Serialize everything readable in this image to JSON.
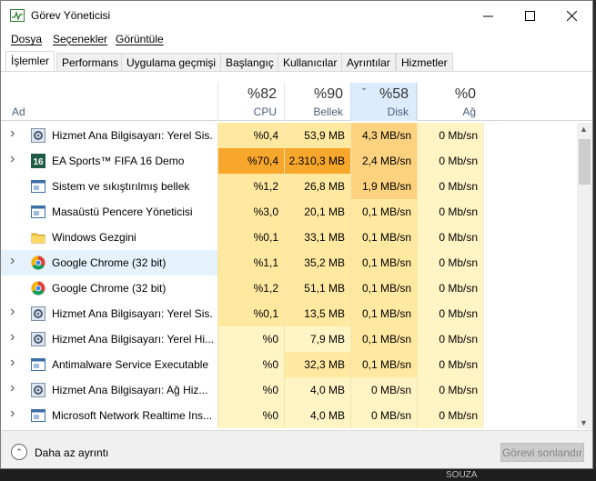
{
  "window": {
    "title": "Görev Yöneticisi"
  },
  "menu": [
    "Dosya",
    "Seçenekler",
    "Görüntüle"
  ],
  "tabs": [
    "İşlemler",
    "Performans",
    "Uygulama geçmişi",
    "Başlangıç",
    "Kullanıcılar",
    "Ayrıntılar",
    "Hizmetler"
  ],
  "columns": {
    "name": "Ad",
    "cpu": {
      "pct": "%82",
      "label": "CPU"
    },
    "mem": {
      "pct": "%90",
      "label": "Bellek"
    },
    "disk": {
      "pct": "%58",
      "label": "Disk"
    },
    "net": {
      "pct": "%0",
      "label": "Ağ"
    }
  },
  "processes": [
    {
      "name": "Hizmet Ana Bilgisayarı: Yerel Sis...",
      "cpu": "%0,4",
      "mem": "53,9 MB",
      "disk": "4,3 MB/sn",
      "net": "0 Mb/sn",
      "icon": "gear-icon",
      "expandable": true
    },
    {
      "name": "EA Sports™ FIFA 16 Demo",
      "cpu": "%70,4",
      "mem": "2.310,3 MB",
      "disk": "2,4 MB/sn",
      "net": "0 Mb/sn",
      "icon": "fifa16-icon",
      "expandable": true
    },
    {
      "name": "Sistem ve sıkıştırılmış bellek",
      "cpu": "%1,2",
      "mem": "26,8 MB",
      "disk": "1,9 MB/sn",
      "net": "0 Mb/sn",
      "icon": "window-icon",
      "expandable": false
    },
    {
      "name": "Masaüstü Pencere Yöneticisi",
      "cpu": "%3,0",
      "mem": "20,1 MB",
      "disk": "0,1 MB/sn",
      "net": "0 Mb/sn",
      "icon": "window-icon",
      "expandable": false
    },
    {
      "name": "Windows Gezgini",
      "cpu": "%0,1",
      "mem": "33,1 MB",
      "disk": "0,1 MB/sn",
      "net": "0 Mb/sn",
      "icon": "folder-icon",
      "expandable": false
    },
    {
      "name": "Google Chrome (32 bit)",
      "cpu": "%1,1",
      "mem": "35,2 MB",
      "disk": "0,1 MB/sn",
      "net": "0 Mb/sn",
      "icon": "chrome-icon",
      "expandable": true
    },
    {
      "name": "Google Chrome (32 bit)",
      "cpu": "%1,2",
      "mem": "51,1 MB",
      "disk": "0,1 MB/sn",
      "net": "0 Mb/sn",
      "icon": "chrome-icon",
      "expandable": false
    },
    {
      "name": "Hizmet Ana Bilgisayarı: Yerel Sis...",
      "cpu": "%0,1",
      "mem": "13,5 MB",
      "disk": "0,1 MB/sn",
      "net": "0 Mb/sn",
      "icon": "gear-icon",
      "expandable": true
    },
    {
      "name": "Hizmet Ana Bilgisayarı: Yerel Hi...",
      "cpu": "%0",
      "mem": "7,9 MB",
      "disk": "0,1 MB/sn",
      "net": "0 Mb/sn",
      "icon": "gear-icon",
      "expandable": true
    },
    {
      "name": "Antimalware Service Executable",
      "cpu": "%0",
      "mem": "32,3 MB",
      "disk": "0,1 MB/sn",
      "net": "0 Mb/sn",
      "icon": "window-icon",
      "expandable": true
    },
    {
      "name": "Hizmet Ana Bilgisayarı: Ağ Hiz...",
      "cpu": "%0",
      "mem": "4,0 MB",
      "disk": "0 MB/sn",
      "net": "0 Mb/sn",
      "icon": "gear-icon",
      "expandable": true
    },
    {
      "name": "Microsoft Network Realtime Ins...",
      "cpu": "%0",
      "mem": "4,0 MB",
      "disk": "0 MB/sn",
      "net": "0 Mb/sn",
      "icon": "window-icon",
      "expandable": true
    }
  ],
  "footer": {
    "fewer_details": "Daha az ayrıntı",
    "end_task": "Görevi sonlandır"
  },
  "taskbar": {
    "text": "SOUZA"
  },
  "colors": {
    "heat_low": "#fff4c4",
    "heat_mid": "#ffe8a0",
    "heat_high": "#fcd27e",
    "heat_max": "#f7a72b",
    "selected_row": "#e5f1fb",
    "sorted_header": "#dcecfc"
  }
}
